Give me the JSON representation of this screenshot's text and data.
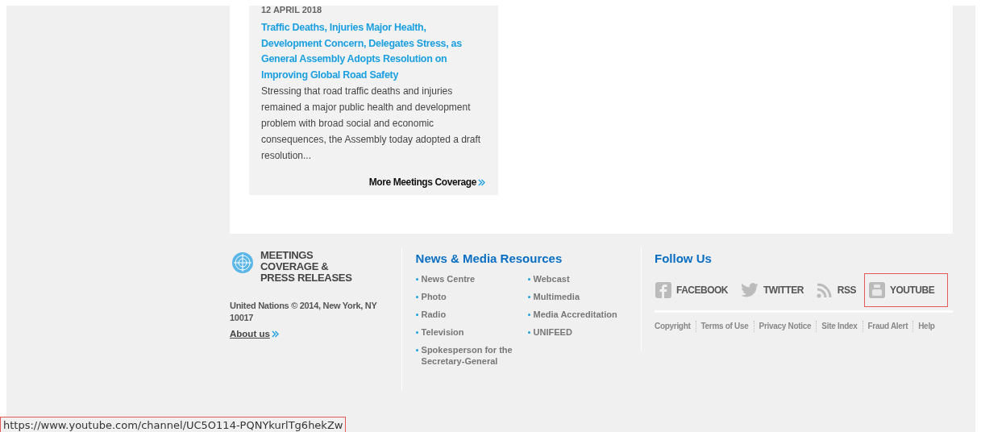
{
  "article": {
    "date": "12 APRIL 2018",
    "title": "Traffic Deaths, Injuries Major Health, Development Concern, Delegates Stress, as General Assembly Adopts Resolution on Improving Global Road Safety",
    "summary": "Stressing that road traffic deaths and injuries remained a major public health and development problem with broad social and economic consequences, the Assembly today adopted a draft resolution...",
    "more_link": "More Meetings Coverage"
  },
  "footer": {
    "brand": {
      "lines": [
        "MEETINGS",
        "COVERAGE &",
        "PRESS RELEASES"
      ],
      "address": "United Nations © 2014, New York, NY 10017",
      "about_link": "About us"
    },
    "resources": {
      "heading": "News & Media Resources",
      "columns": [
        [
          "News Centre",
          "Photo",
          "Radio",
          "Television",
          "Spokesperson for the Secretary-General"
        ],
        [
          "Webcast",
          "Multimedia",
          "Media Accreditation",
          "UNIFEED"
        ]
      ]
    },
    "follow": {
      "heading": "Follow Us",
      "social": [
        {
          "kind": "facebook",
          "label": "FACEBOOK",
          "highlighted": false
        },
        {
          "kind": "twitter",
          "label": "TWITTER",
          "highlighted": false
        },
        {
          "kind": "rss",
          "label": "RSS",
          "highlighted": false
        },
        {
          "kind": "youtube",
          "label": "YOUTUBE",
          "highlighted": true
        }
      ],
      "legal_links": [
        "Copyright",
        "Terms of Use",
        "Privacy Notice",
        "Site Index",
        "Fraud Alert",
        "Help"
      ]
    }
  },
  "status_bar": {
    "url": "https://www.youtube.com/channel/UC5O114-PQNYkurlTg6hekZw"
  }
}
